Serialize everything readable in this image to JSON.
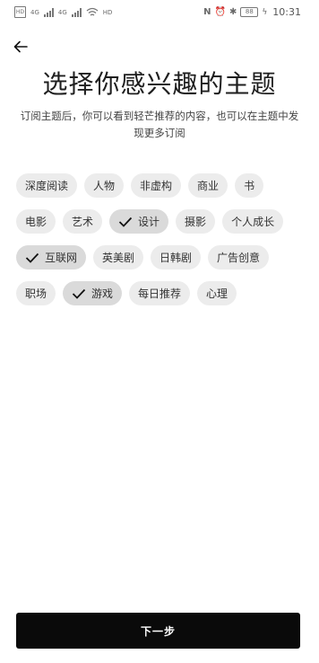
{
  "status_bar": {
    "sim1": "HD",
    "sim2": "HD",
    "net1": "4G",
    "net2": "4G",
    "wifi_badge": "HD",
    "battery": "88",
    "time": "10:31"
  },
  "header": {
    "back_icon": "arrow-left-icon"
  },
  "title": "选择你感兴趣的主题",
  "subtitle": "订阅主题后，你可以看到轻芒推荐的内容，也可以在主题中发现更多订阅",
  "topics": [
    {
      "label": "深度阅读",
      "selected": false
    },
    {
      "label": "人物",
      "selected": false
    },
    {
      "label": "非虚构",
      "selected": false
    },
    {
      "label": "商业",
      "selected": false
    },
    {
      "label": "书",
      "selected": false
    },
    {
      "label": "电影",
      "selected": false
    },
    {
      "label": "艺术",
      "selected": false
    },
    {
      "label": "设计",
      "selected": true
    },
    {
      "label": "摄影",
      "selected": false
    },
    {
      "label": "个人成长",
      "selected": false
    },
    {
      "label": "互联网",
      "selected": true
    },
    {
      "label": "英美剧",
      "selected": false
    },
    {
      "label": "日韩剧",
      "selected": false
    },
    {
      "label": "广告创意",
      "selected": false
    },
    {
      "label": "职场",
      "selected": false
    },
    {
      "label": "游戏",
      "selected": true
    },
    {
      "label": "每日推荐",
      "selected": false
    },
    {
      "label": "心理",
      "selected": false
    }
  ],
  "next_button": "下一步",
  "colors": {
    "background": "#ffffff",
    "chip": "#ececec",
    "chip_selected": "#dadada",
    "button": "#0a0a0a"
  }
}
